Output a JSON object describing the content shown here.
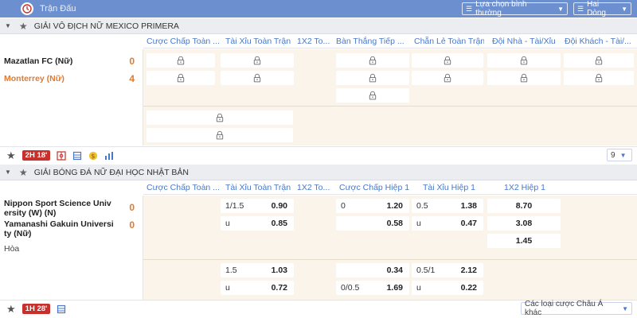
{
  "header": {
    "title": "Trận Đấu",
    "view_select": "Lựa chọn bình thường",
    "lines_select": "Hai Dòng"
  },
  "leagues": [
    {
      "name": "GIẢI VÔ ĐỊCH NỮ MEXICO PRIMERA",
      "columns": [
        "Cược Chấp Toàn ...",
        "Tài Xỉu Toàn Trận",
        "1X2 To...",
        "Bàn Thắng Tiếp ...",
        "Chẵn Lẻ Toàn Trận",
        "Đội Nhà - Tài/Xỉu",
        "Đội Khách - Tài/..."
      ],
      "home_team": "Mazatlan FC (Nữ)",
      "home_score": "0",
      "away_team": "Monterrey (Nữ)",
      "away_score": "4",
      "live_time": "2H 18'",
      "more_markets": "9"
    },
    {
      "name": "GIẢI BÓNG ĐÁ NỮ ĐẠI HỌC NHẬT BẢN",
      "columns": [
        "Cược Chấp Toàn ...",
        "Tài Xỉu Toàn Trận",
        "1X2 To...",
        "Cược Chấp Hiệp 1",
        "Tài Xỉu Hiệp 1",
        "1X2 Hiệp 1"
      ],
      "home_team_line1": "Nippon Sport Science Univ",
      "home_team_line2": "ersity (W) (N)",
      "home_score": "0",
      "away_team_line1": "Yamanashi Gakuin Universi",
      "away_team_line2": "ty (Nữ)",
      "away_score": "0",
      "draw_label": "Hòa",
      "live_time": "1H 28'",
      "other_markets": "Các loại cược Châu Á khác",
      "odds": {
        "r1": {
          "ou_line": "1/1.5",
          "ou": "0.90",
          "h1hdp_line": "0",
          "h1hdp": "1.20",
          "h1ou_line": "0.5",
          "h1ou": "1.38",
          "h1x2": "8.70"
        },
        "r2": {
          "ou_line": "u",
          "ou": "0.85",
          "h1hdp": "0.58",
          "h1ou_line": "u",
          "h1ou": "0.47",
          "h1x2": "3.08"
        },
        "r3": {
          "h1x2": "1.45"
        },
        "r4": {
          "ou_line": "1.5",
          "ou": "1.03",
          "h1hdp": "0.34",
          "h1ou_line": "0.5/1",
          "h1ou": "2.12"
        },
        "r5": {
          "ou_line": "u",
          "ou": "0.72",
          "h1hdp_line": "0/0.5",
          "h1hdp": "1.69",
          "h1ou_line": "u",
          "h1ou": "0.22"
        }
      }
    }
  ],
  "colors": {
    "topbar": "#6b8fcf",
    "accent": "#4a78c8",
    "score": "#e07a32",
    "live_badge": "#c9302c",
    "odds_bg": "#fbf4ea"
  }
}
